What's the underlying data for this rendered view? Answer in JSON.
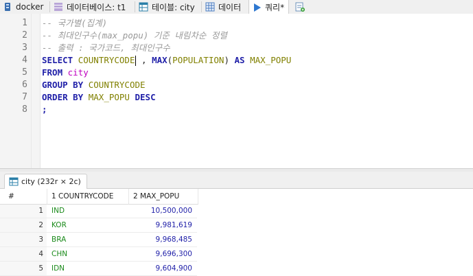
{
  "tabs": [
    {
      "label": "docker",
      "icon": "database-connection-icon"
    },
    {
      "label": "데이터베이스: t1",
      "icon": "database-icon"
    },
    {
      "label": "테이블: city",
      "icon": "table-icon"
    },
    {
      "label": "데이터",
      "icon": "grid-icon"
    },
    {
      "label": "쿼리*",
      "icon": "run-query-icon"
    },
    {
      "label": "",
      "icon": "new-query-icon"
    }
  ],
  "editor": {
    "line_numbers": [
      "1",
      "2",
      "3",
      "4",
      "5",
      "6",
      "7",
      "8"
    ],
    "lines": {
      "l1": "-- 국가별(집계)",
      "l2": "-- 최대인구수(max_popu) 기준 내림차순 정렬",
      "l3": "-- 출력 : 국가코드, 최대인구수",
      "l4_kw1": "SELECT",
      "l4_id1": "COUNTRYCODE",
      "l4_p1": " , ",
      "l4_kw2": "MAX",
      "l4_p2": "(",
      "l4_id2": "POPULATION",
      "l4_p3": ")",
      "l4_kw3": "AS",
      "l4_id3": "MAX_POPU",
      "l5_kw": "FROM",
      "l5_tbl": "city",
      "l6_kw": "GROUP BY",
      "l6_id": "COUNTRYCODE",
      "l7_kw1": "ORDER BY",
      "l7_id": "MAX_POPU",
      "l7_kw2": "DESC",
      "l8": ";"
    }
  },
  "result": {
    "tab_label": "city (232r × 2c)",
    "header": {
      "rownum": "#",
      "col1": "1 COUNTRYCODE",
      "col2": "2 MAX_POPU"
    },
    "rows": [
      {
        "n": "1",
        "cc": "IND",
        "mp": "10,500,000"
      },
      {
        "n": "2",
        "cc": "KOR",
        "mp": "9,981,619"
      },
      {
        "n": "3",
        "cc": "BRA",
        "mp": "9,968,485"
      },
      {
        "n": "4",
        "cc": "CHN",
        "mp": "9,696,300"
      },
      {
        "n": "5",
        "cc": "IDN",
        "mp": "9,604,900"
      }
    ]
  },
  "colors": {
    "keyword": "#1f1fa8",
    "identifier": "#808000",
    "table": "#c000c0",
    "comment": "#9a9a9a",
    "string_cell": "#1a8a1a",
    "number_cell": "#1f1fa8"
  }
}
